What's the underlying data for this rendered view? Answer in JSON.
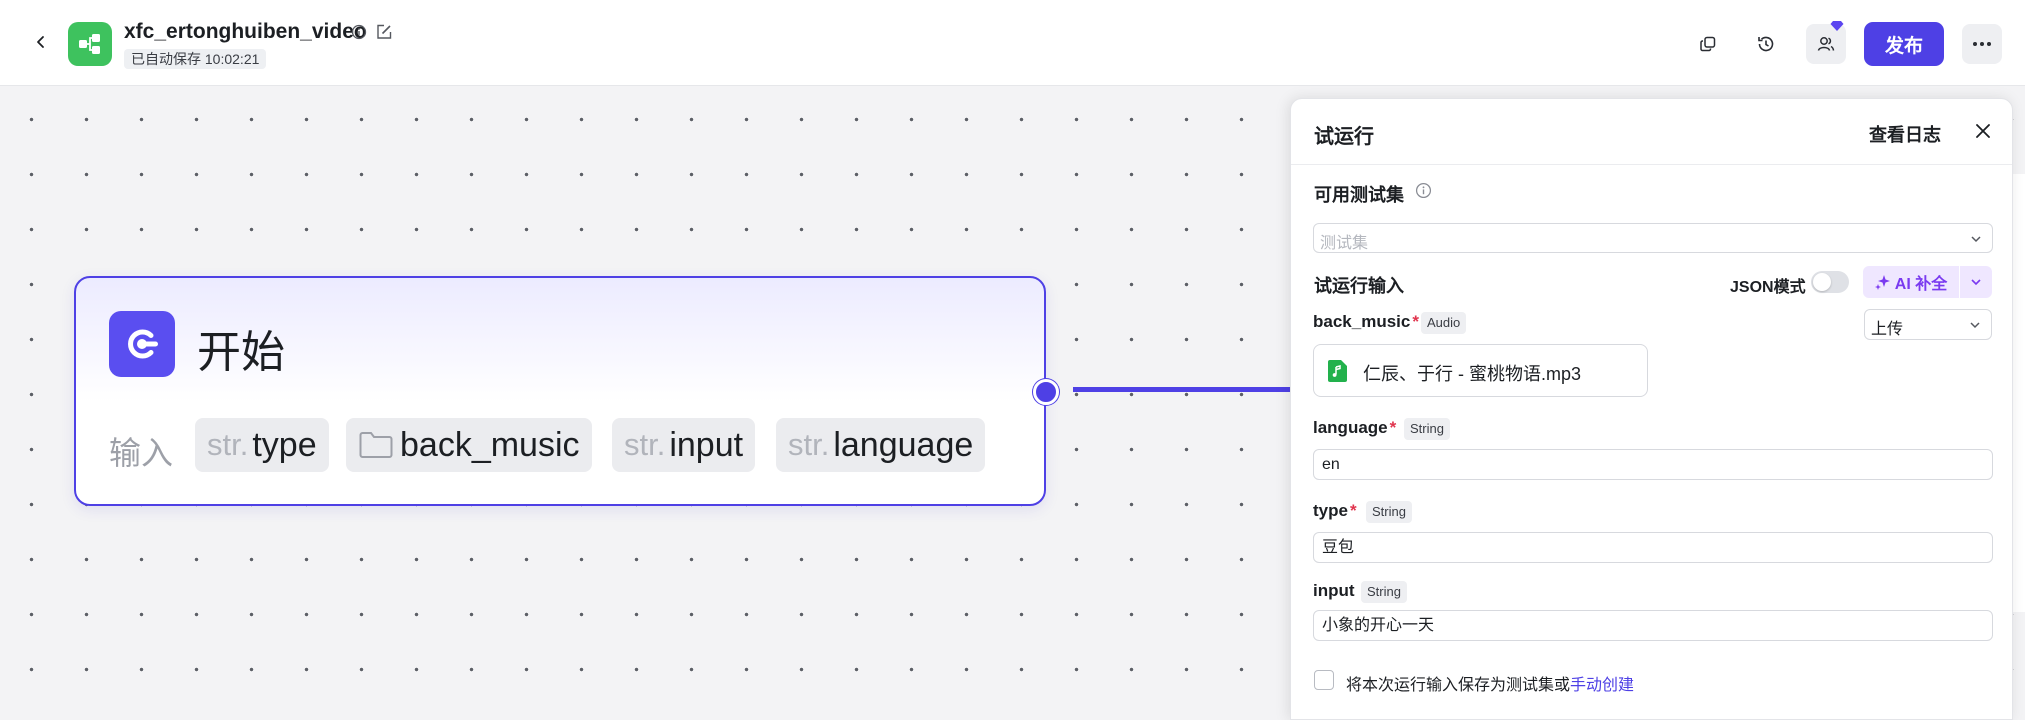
{
  "header": {
    "app_title": "xfc_ertonghuiben_video",
    "autosave_text": "已自动保存 10:02:21",
    "publish_label": "发布"
  },
  "node": {
    "title": "开始",
    "input_label": "输入",
    "params": [
      {
        "prefix": "str.",
        "name": "type"
      },
      {
        "prefix": "",
        "name": "back_music"
      },
      {
        "prefix": "str.",
        "name": "input"
      },
      {
        "prefix": "str.",
        "name": "language"
      }
    ]
  },
  "panel": {
    "title": "试运行",
    "view_log": "查看日志",
    "testset_label": "可用测试集",
    "testset_placeholder": "测试集",
    "run_input_label": "试运行输入",
    "json_mode_label": "JSON模式",
    "ai_fill_label": "AI 补全",
    "fields": {
      "back_music": {
        "name": "back_music",
        "type": "Audio",
        "mode": "上传",
        "file": "仁辰、于行 - 蜜桃物语.mp3"
      },
      "language": {
        "name": "language",
        "type": "String",
        "value": "en"
      },
      "type": {
        "name": "type",
        "type": "String",
        "value": "豆包"
      },
      "input": {
        "name": "input",
        "type": "String",
        "value": "小象的开心一天"
      }
    },
    "required_mark": "*",
    "save_text": "将本次运行输入保存为测试集或",
    "manual_create": "手动创建"
  },
  "colors": {
    "accent": "#4e40e5",
    "logo_green": "#3ec25e",
    "ai_purple": "#7a3af0",
    "required_red": "#e0344d",
    "file_green": "#22b14c"
  }
}
